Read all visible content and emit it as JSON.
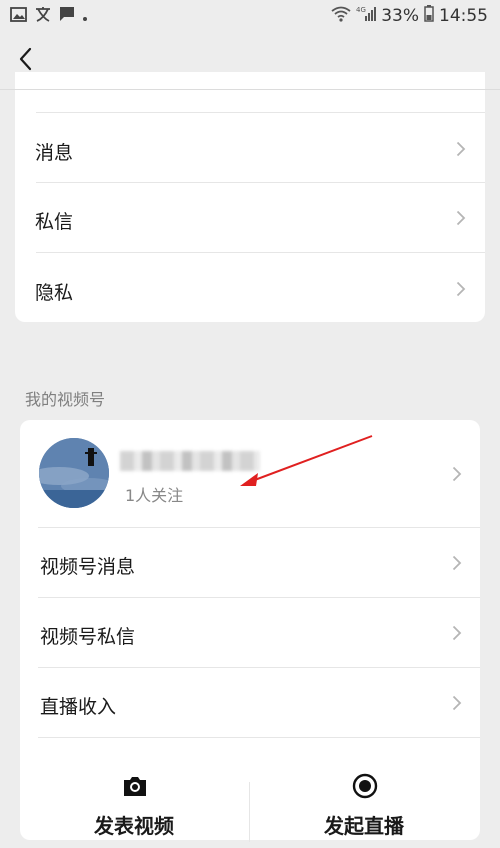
{
  "status_bar": {
    "battery": "33%",
    "time": "14:55",
    "signal": "4G"
  },
  "settings_card": {
    "items": [
      {
        "label": "消息"
      },
      {
        "label": "私信"
      },
      {
        "label": "隐私"
      }
    ]
  },
  "channels_section": {
    "title": "我的视频号",
    "profile": {
      "followers": "1人关注"
    },
    "items": [
      {
        "label": "视频号消息"
      },
      {
        "label": "视频号私信"
      },
      {
        "label": "直播收入"
      }
    ],
    "actions": {
      "publish_video": "发表视频",
      "start_live": "发起直播"
    }
  },
  "colors": {
    "background": "#ededed",
    "card": "#ffffff",
    "annotation_arrow": "#e02020"
  }
}
